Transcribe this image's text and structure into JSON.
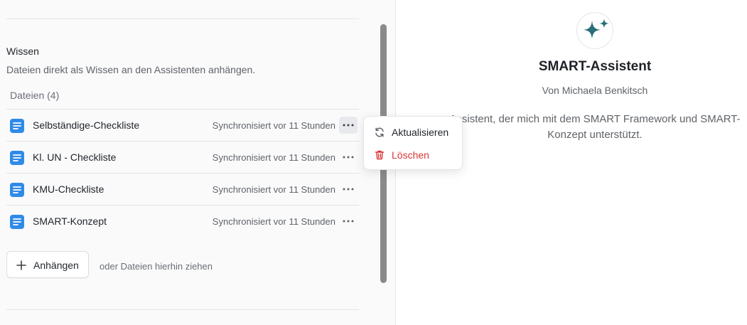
{
  "knowledge": {
    "title": "Wissen",
    "description": "Dateien direkt als Wissen an den Assistenten anhängen.",
    "files_header": "Dateien (4)",
    "files": [
      {
        "name": "Selbständige-Checkliste",
        "status": "Synchronisiert vor 11 Stunden"
      },
      {
        "name": "Kl. UN - Checkliste",
        "status": "Synchronisiert vor 11 Stunden"
      },
      {
        "name": "KMU-Checkliste",
        "status": "Synchronisiert vor 11 Stunden"
      },
      {
        "name": "SMART-Konzept",
        "status": "Synchronisiert vor 11 Stunden"
      }
    ],
    "attach_label": "Anhängen",
    "drop_hint": "oder Dateien hierhin ziehen"
  },
  "context_menu": {
    "refresh_label": "Aktualisieren",
    "delete_label": "Löschen"
  },
  "assistant": {
    "name": "SMART-Assistent",
    "author": "Von Michaela Benkitsch",
    "description": "Assistent, der mich mit dem SMART Framework und SMART-Konzept unterstützt."
  },
  "colors": {
    "file_icon": "#2f8ae8",
    "avatar_sparkle": "#2a6e78",
    "delete": "#d93636"
  },
  "icons": {
    "file": "document-icon",
    "more": "more-horizontal-icon",
    "attach": "plus-icon",
    "refresh": "refresh-icon",
    "delete": "trash-icon",
    "avatar": "sparkles-icon"
  }
}
